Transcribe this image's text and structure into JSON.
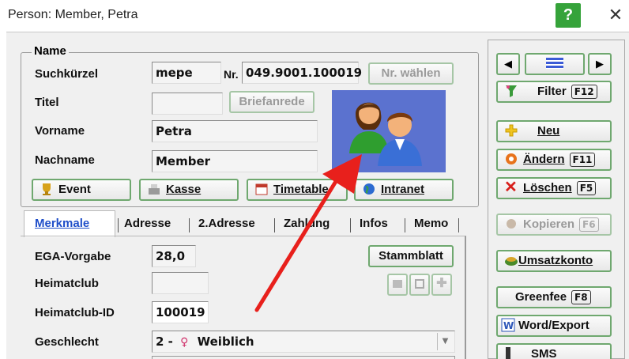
{
  "window": {
    "title": "Person: Member, Petra",
    "help_label": "?",
    "close_label": "✕"
  },
  "name_group": {
    "legend": "Name",
    "suchkuerzel_label": "Suchkürzel",
    "suchkuerzel_value": "mepe",
    "nr_label": "Nr.",
    "nr_value": "049.9001.100019",
    "nr_waehlen_button": "Nr. wählen",
    "titel_label": "Titel",
    "titel_value": "",
    "briefanrede_button": "Briefanrede",
    "vorname_label": "Vorname",
    "vorname_value": "Petra",
    "nachname_label": "Nachname",
    "nachname_value": "Member"
  },
  "action_buttons": {
    "event": "Event",
    "kasse": "Kasse",
    "timetable": "Timetable",
    "intranet": "Intranet"
  },
  "tabs": [
    "Merkmale",
    "Adresse",
    "2.Adresse",
    "Zahlung",
    "Infos",
    "Memo"
  ],
  "merkmale": {
    "ega_label": "EGA-Vorgabe",
    "ega_value": "28,0",
    "heimatclub_label": "Heimatclub",
    "heimatclub_value": "",
    "heimatclub_id_label": "Heimatclub-ID",
    "heimatclub_id_value": "100019",
    "geschlecht_label": "Geschlecht",
    "geschlecht_code": "2 -",
    "geschlecht_value": "Weiblich",
    "stammblatt_button": "Stammblatt"
  },
  "sidebar": {
    "filter": "Filter",
    "filter_key": "F12",
    "neu": "Neu",
    "aendern": "Ändern",
    "aendern_key": "F11",
    "loeschen": "Löschen",
    "loeschen_key": "F5",
    "kopieren": "Kopieren",
    "kopieren_key": "F6",
    "umsatzkonto": "Umsatzkonto",
    "greenfee": "Greenfee",
    "greenfee_key": "F8",
    "word_export": "Word/Export",
    "sms": "SMS"
  },
  "colors": {
    "accent_green": "#35a33a",
    "avatar_bg": "#5b72cf",
    "arrow_red": "#e8201c",
    "tab_active": "#1f4ec9"
  }
}
